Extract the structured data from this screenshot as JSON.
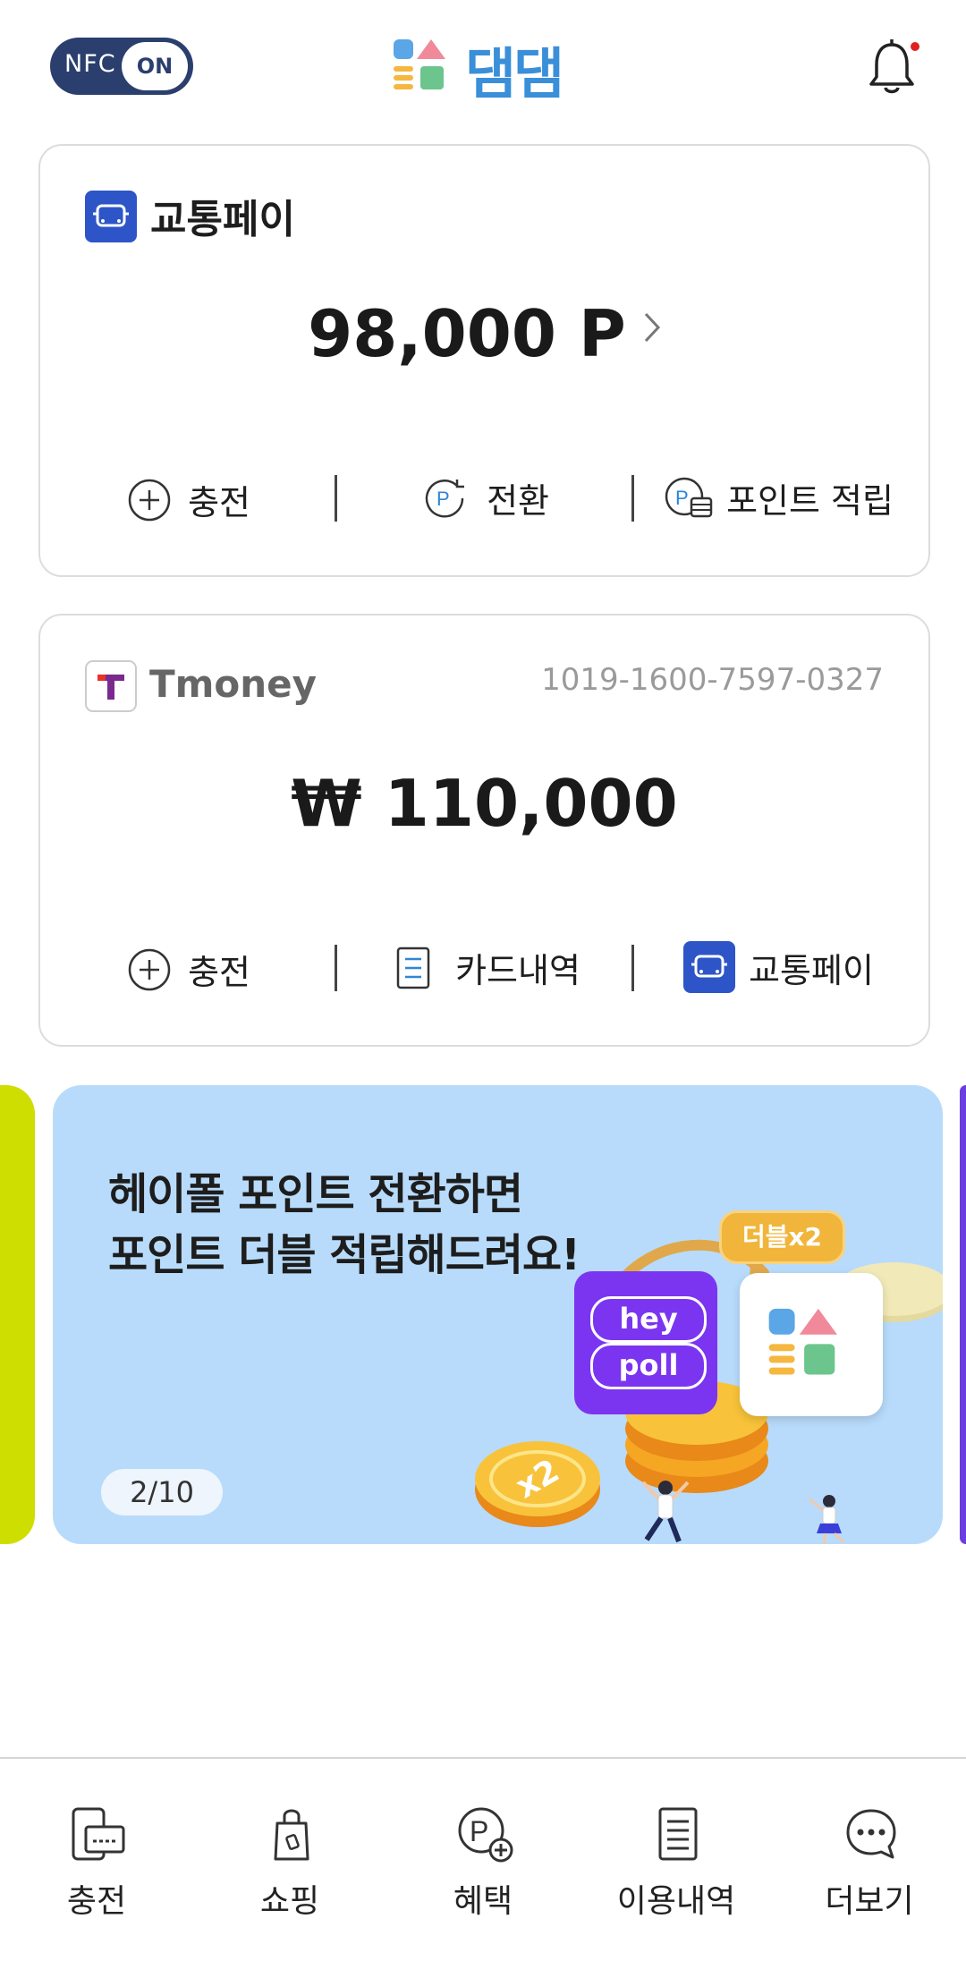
{
  "header": {
    "nfc_label": "NFC",
    "nfc_state": "ON",
    "app_name": "댐댐",
    "notification_dot_color": "#e02020"
  },
  "pay_card": {
    "title": "교통페이",
    "amount": "98,000 P",
    "actions": [
      "충전",
      "전환",
      "포인트 적립"
    ]
  },
  "tmoney_card": {
    "brand": "Tmoney",
    "card_number": "1019-1600-7597-0327",
    "amount": "₩ 110,000",
    "actions": [
      "충전",
      "카드내역",
      "교통페이"
    ]
  },
  "banner": {
    "line1": "헤이폴 포인트 전환하면",
    "line2": "포인트 더블 적립해드려요!",
    "badge": "더블x2",
    "hey_label": "hey",
    "poll_label": "poll",
    "coin_label": "x2",
    "pager": "2/10"
  },
  "bottom_nav": [
    {
      "label": "충전",
      "icon": "charge-device-icon"
    },
    {
      "label": "쇼핑",
      "icon": "shopping-bag-icon"
    },
    {
      "label": "혜택",
      "icon": "point-plus-icon"
    },
    {
      "label": "이용내역",
      "icon": "receipt-list-icon"
    },
    {
      "label": "더보기",
      "icon": "chat-more-icon"
    }
  ],
  "colors": {
    "brand_blue": "#2d55c8",
    "nfc_bg": "#2b3f6e",
    "banner_bg": "#b8dbfb",
    "logo_blue": "#3a8fd8"
  }
}
